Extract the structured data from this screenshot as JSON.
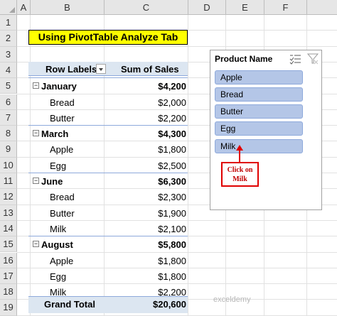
{
  "columns": [
    "A",
    "B",
    "C",
    "D",
    "E",
    "F"
  ],
  "rows": [
    "1",
    "2",
    "3",
    "4",
    "5",
    "6",
    "7",
    "8",
    "9",
    "10",
    "11",
    "12",
    "13",
    "14",
    "15",
    "16",
    "17",
    "18",
    "19"
  ],
  "title": "Using PivotTable Analyze Tab",
  "pivot": {
    "header_labels": "Row Labels",
    "header_sum": "Sum of Sales",
    "lines": [
      {
        "label": "January",
        "value": "$4,200",
        "group": true
      },
      {
        "label": "Bread",
        "value": "$2,000",
        "group": false
      },
      {
        "label": "Butter",
        "value": "$2,200",
        "group": false
      },
      {
        "label": "March",
        "value": "$4,300",
        "group": true
      },
      {
        "label": "Apple",
        "value": "$1,800",
        "group": false
      },
      {
        "label": "Egg",
        "value": "$2,500",
        "group": false
      },
      {
        "label": "June",
        "value": "$6,300",
        "group": true
      },
      {
        "label": "Bread",
        "value": "$2,300",
        "group": false
      },
      {
        "label": "Butter",
        "value": "$1,900",
        "group": false
      },
      {
        "label": "Milk",
        "value": "$2,100",
        "group": false
      },
      {
        "label": "August",
        "value": "$5,800",
        "group": true
      },
      {
        "label": "Apple",
        "value": "$1,800",
        "group": false
      },
      {
        "label": "Egg",
        "value": "$1,800",
        "group": false
      },
      {
        "label": "Milk",
        "value": "$2,200",
        "group": false
      }
    ],
    "grand_total_label": "Grand Total",
    "grand_total_value": "$20,600",
    "collapse_symbol": "−"
  },
  "slicer": {
    "title": "Product Name",
    "items": [
      "Apple",
      "Bread",
      "Butter",
      "Egg",
      "Milk"
    ],
    "multiselect_icon": "multi-select-icon",
    "clear_filter_icon": "clear-filter-icon"
  },
  "callout": {
    "line1": "Click on",
    "line2": "Milk"
  },
  "watermark": "exceldemy"
}
